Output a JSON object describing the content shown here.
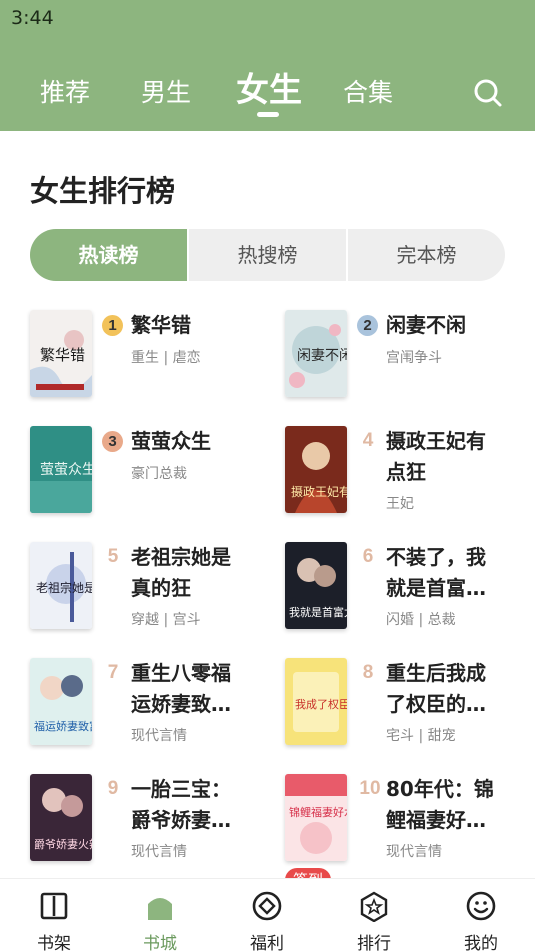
{
  "status_bar": {
    "time": "3:44"
  },
  "top_tabs": [
    {
      "label": "推荐"
    },
    {
      "label": "男生"
    },
    {
      "label": "女生",
      "active": true
    },
    {
      "label": "合集"
    }
  ],
  "section": {
    "title": "女生排行榜"
  },
  "segments": [
    {
      "label": "热读榜",
      "active": true
    },
    {
      "label": "热搜榜"
    },
    {
      "label": "完本榜"
    }
  ],
  "books": [
    {
      "rank": "1",
      "title": "繁华错",
      "tags": "重生 | 虐恋",
      "cover_title": "繁华错"
    },
    {
      "rank": "2",
      "title": "闲妻不闲",
      "tags": "宫闱争斗",
      "cover_title": "闲妻不闲"
    },
    {
      "rank": "3",
      "title": "萤萤众生",
      "tags": "豪门总裁",
      "cover_title": "萤萤众生"
    },
    {
      "rank": "4",
      "title": "摄政王妃有点狂",
      "tags": "王妃",
      "cover_title": "摄政王妃有点狂"
    },
    {
      "rank": "5",
      "title": "老祖宗她是真的狂",
      "tags": "穿越 | 宫斗",
      "cover_title": "老祖宗她是真的狂"
    },
    {
      "rank": "6",
      "title": "不装了，我就是首富…",
      "tags": "闪婚 | 总裁",
      "cover_title": "我就是首富太太"
    },
    {
      "rank": "7",
      "title": "重生八零福运娇妻致…",
      "tags": "现代言情",
      "cover_title": "福运娇妻致富忙"
    },
    {
      "rank": "8",
      "title": "重生后我成了权臣的…",
      "tags": "宅斗 | 甜宠",
      "cover_title": "我成了权臣的娇"
    },
    {
      "rank": "9",
      "title": "一胎三宝：爵爷娇妻…",
      "tags": "现代言情",
      "cover_title": "爵爷娇妻火辣辣"
    },
    {
      "rank": "10",
      "title": "80年代：锦鲤福妻好…",
      "tags": "现代言情",
      "cover_title": "锦鲤福妻好水嫩"
    }
  ],
  "bottom_nav": [
    {
      "label": "书架",
      "icon": "book-icon"
    },
    {
      "label": "书城",
      "icon": "store-icon",
      "active": true
    },
    {
      "label": "福利",
      "icon": "gift-icon"
    },
    {
      "label": "排行",
      "icon": "rank-star-icon"
    },
    {
      "label": "我的",
      "icon": "smiley-icon"
    }
  ],
  "badge": {
    "label": "签到"
  },
  "colors": {
    "accent": "#8db57f",
    "badge": "#e84a4a",
    "rank_number": "#e0b9a3"
  }
}
